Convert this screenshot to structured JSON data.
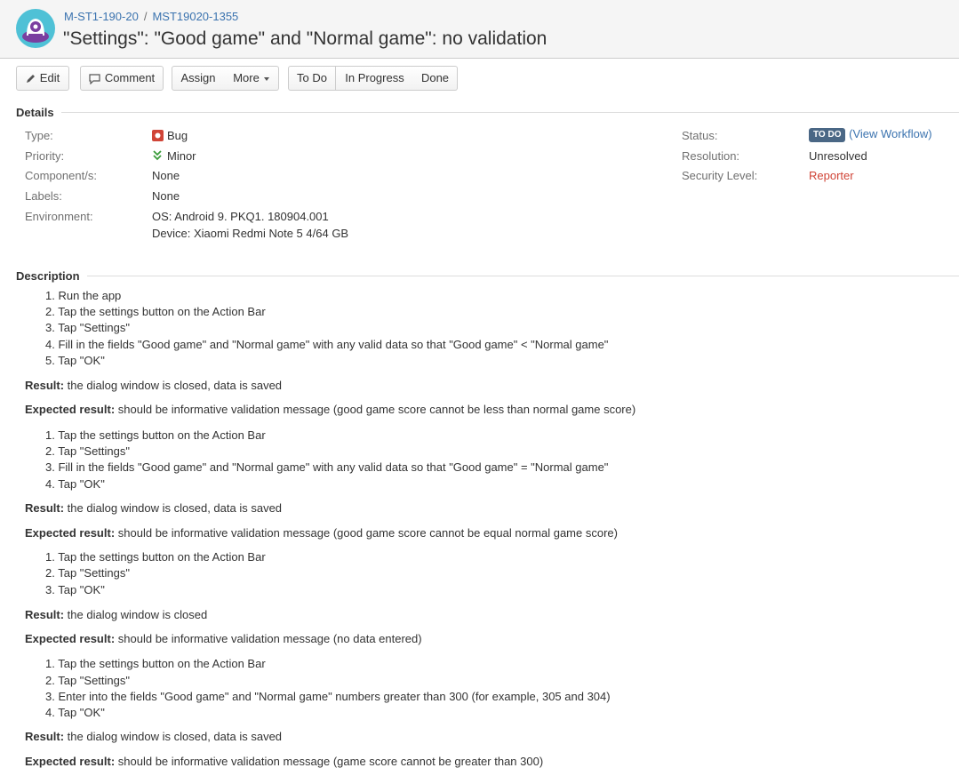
{
  "breadcrumbs": {
    "project": "M-ST1-190-20",
    "separator": "/",
    "issue_key": "MST19020-1355"
  },
  "issue_title": "\"Settings\": \"Good game\" and \"Normal game\": no validation",
  "toolbar": {
    "edit": "Edit",
    "comment": "Comment",
    "assign": "Assign",
    "more": "More",
    "todo": "To Do",
    "in_progress": "In Progress",
    "done": "Done"
  },
  "details": {
    "heading": "Details",
    "type_label": "Type:",
    "type_value": "Bug",
    "priority_label": "Priority:",
    "priority_value": "Minor",
    "components_label": "Component/s:",
    "components_value": "None",
    "labels_label": "Labels:",
    "labels_value": "None",
    "environment_label": "Environment:",
    "environment_line1": "OS: Android 9. PKQ1. 180904.001",
    "environment_line2": "Device: Xiaomi Redmi Note 5 4/64 GB",
    "status_label": "Status:",
    "status_value": "TO DO",
    "view_workflow_open": "(",
    "view_workflow": "View Workflow",
    "view_workflow_close": ")",
    "resolution_label": "Resolution:",
    "resolution_value": "Unresolved",
    "security_label": "Security Level:",
    "security_value": "Reporter"
  },
  "description": {
    "heading": "Description",
    "result_label": "Result:",
    "expected_label": "Expected result:",
    "blocks": [
      {
        "steps": [
          "1. Run the app",
          "2. Tap the settings button on the Action Bar",
          "3. Tap \"Settings\"",
          "4. Fill in the fields \"Good game\" and \"Normal game\" with any valid data so that \"Good game\" < \"Normal game\"",
          "5. Tap \"OK\""
        ],
        "result": " the dialog window is closed, data is saved",
        "expected": " should be informative validation message (good game score cannot be less than normal game score)"
      },
      {
        "steps": [
          "1. Tap the settings button on the Action Bar",
          "2. Tap \"Settings\"",
          "3. Fill in the fields \"Good game\" and \"Normal game\" with any valid data so that \"Good game\" = \"Normal game\"",
          "4. Tap \"OK\""
        ],
        "result": " the dialog window is closed, data is saved",
        "expected": " should be informative validation message (good game score cannot be equal normal game score)"
      },
      {
        "steps": [
          "1. Tap the settings button on the Action Bar",
          "2. Tap \"Settings\"",
          "3. Tap \"OK\""
        ],
        "result": " the dialog window is closed",
        "expected": " should be informative validation message (no data entered)"
      },
      {
        "steps": [
          "1. Tap the settings button on the Action Bar",
          "2. Tap \"Settings\"",
          "3. Enter into the fields \"Good game\" and \"Normal game\" numbers greater than 300 (for example, 305 and 304)",
          "4. Tap \"OK\""
        ],
        "result": " the dialog window is closed, data is saved",
        "expected": " should be informative validation message (game score cannot be greater than 300)"
      }
    ]
  },
  "colors": {
    "link": "#3b73af",
    "status_lozenge": "#4a6785",
    "security": "#d04437",
    "bug_icon": "#d04437",
    "minor_icon": "#3a9c3a"
  }
}
